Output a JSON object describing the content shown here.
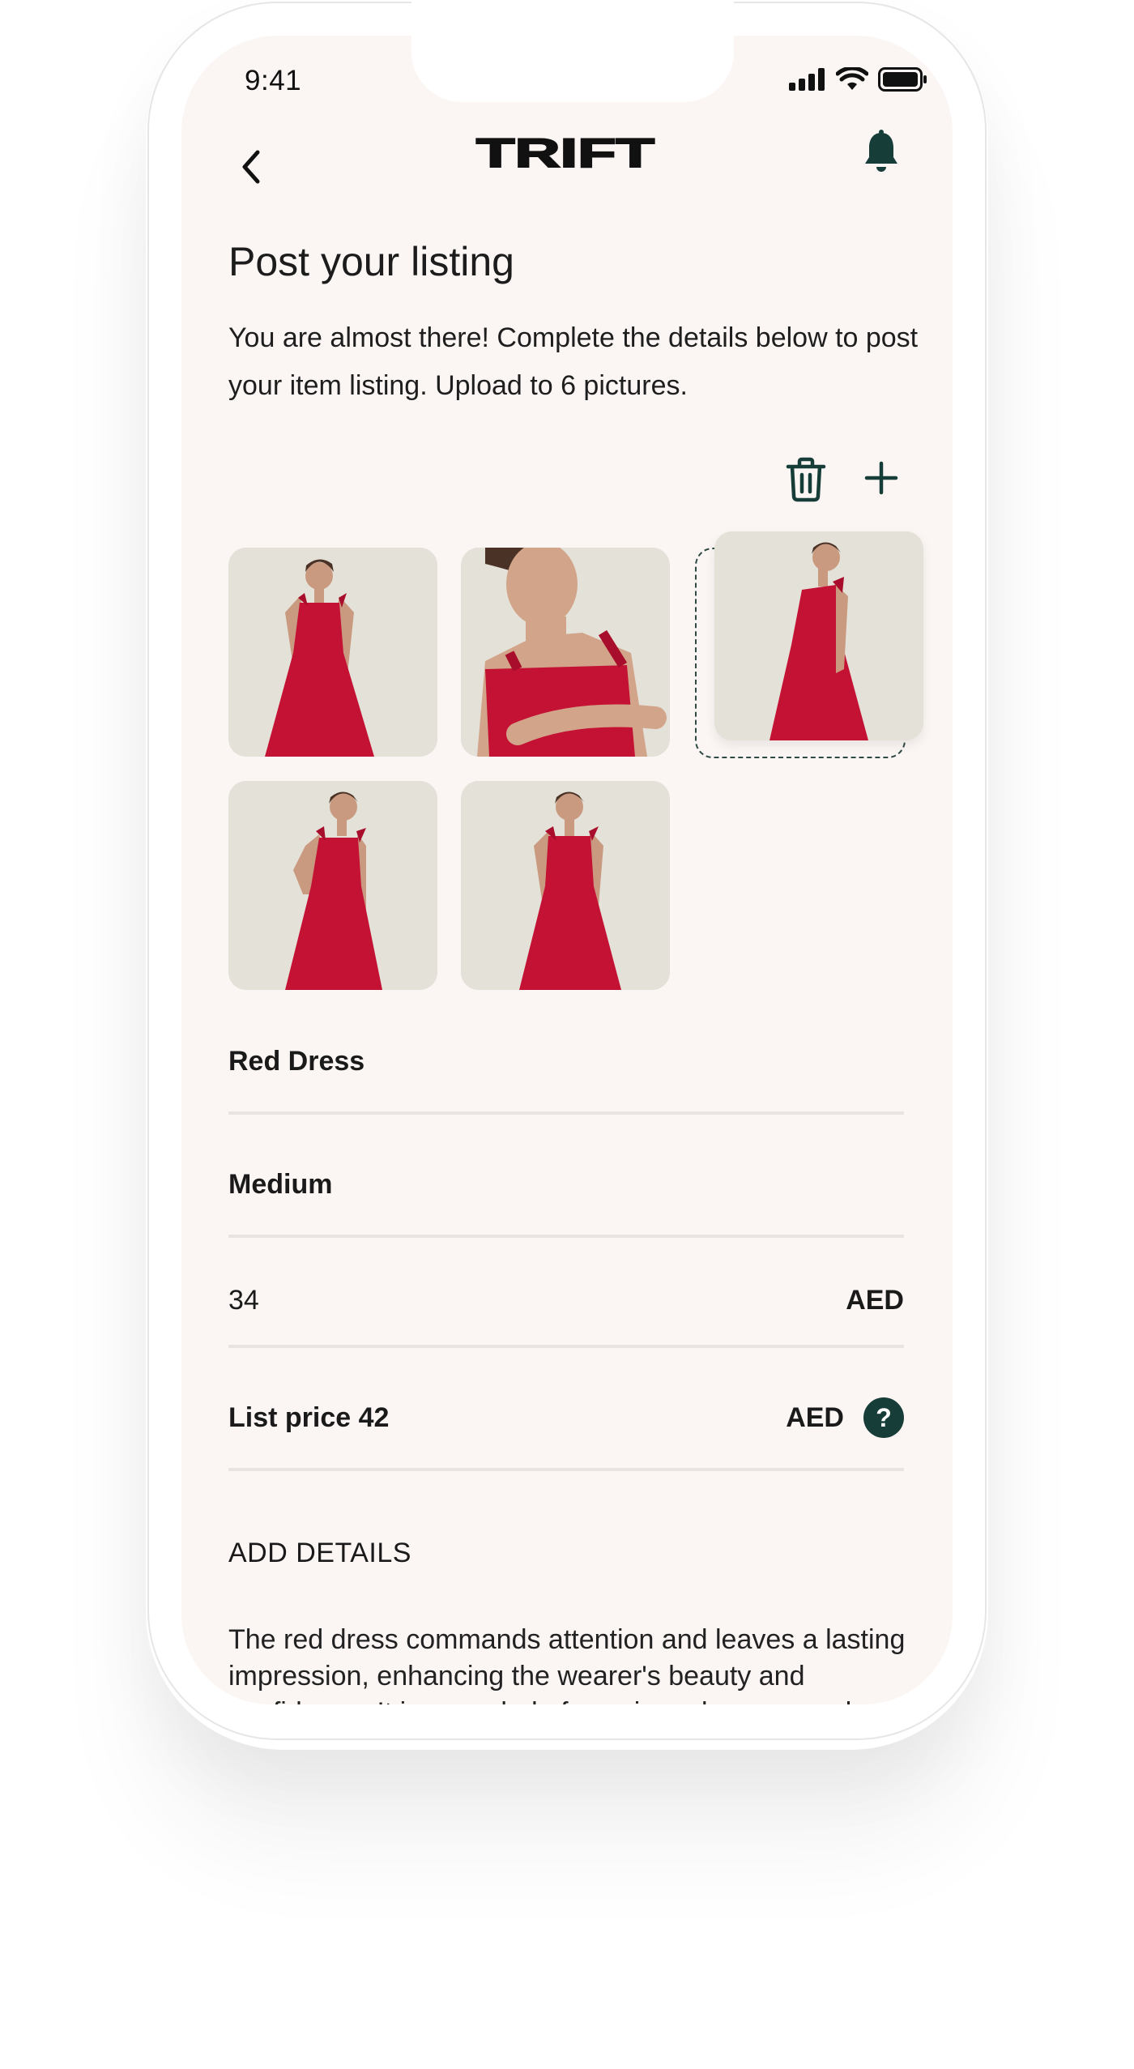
{
  "status_bar": {
    "time": "9:41"
  },
  "header": {
    "brand": "TRIFT"
  },
  "page": {
    "title": "Post your listing",
    "intro": "You are almost there! Complete the details below to post your item listing. Upload to 6 pictures."
  },
  "photos": [
    {
      "alt": "Red dress front view"
    },
    {
      "alt": "Red dress close-up"
    },
    {
      "alt": "Red dress side view"
    },
    {
      "alt": "Red dress hand on hip"
    },
    {
      "alt": "Red dress full front"
    }
  ],
  "form": {
    "name": "Red Dress",
    "size": "Medium",
    "price": "34",
    "price_currency": "AED",
    "list_price": "List price 42",
    "list_price_currency": "AED",
    "help_glyph": "?"
  },
  "details": {
    "label": "ADD DETAILS",
    "text": "The red dress commands attention and leaves a lasting impression, enhancing the wearer's beauty and confidence. It is a symbol of passion, elegance and style."
  },
  "colors": {
    "screen_bg": "#fbf6f4",
    "accent": "#173d38",
    "dress": "#c41235"
  },
  "icons": [
    "back-icon",
    "bell-icon",
    "trash-icon",
    "plus-icon",
    "help-icon",
    "signal-icon",
    "wifi-icon",
    "battery-icon"
  ]
}
